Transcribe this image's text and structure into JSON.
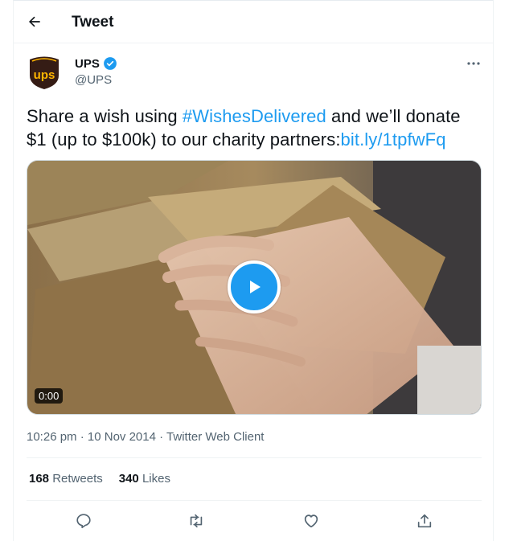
{
  "header": {
    "title": "Tweet"
  },
  "tweet": {
    "author_name": "UPS",
    "handle": "@UPS",
    "text_part1": "Share a wish using ",
    "hashtag": "#WishesDelivered",
    "text_part2": " and we’ll donate $1 (up to $100k) to our charity partners:",
    "link": "bit.ly/1tpfwFq",
    "video_duration": "0:00",
    "time": "10:26 pm",
    "date": "10 Nov 2014",
    "source": "Twitter Web Client",
    "retweets_count": "168",
    "retweets_label": "Retweets",
    "likes_count": "340",
    "likes_label": "Likes"
  },
  "icons": {
    "back": "arrow-left-icon",
    "verified": "verified-badge-icon",
    "more": "more-horizontal-icon",
    "play": "play-icon",
    "reply": "reply-icon",
    "retweet": "retweet-icon",
    "like": "heart-icon",
    "share": "share-icon"
  },
  "colors": {
    "accent": "#1d9bf0",
    "text": "#0f1419",
    "secondary": "#536471",
    "ups_brown": "#351c15",
    "ups_gold": "#ffb500"
  }
}
